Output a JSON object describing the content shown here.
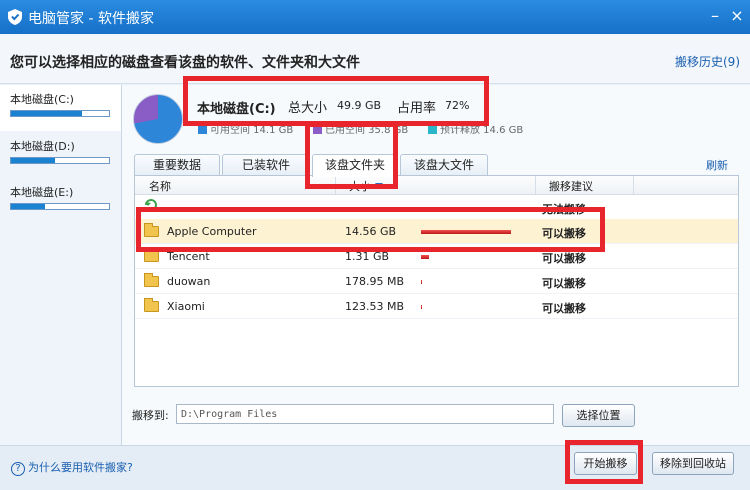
{
  "window": {
    "title": "电脑管家 - 软件搬家"
  },
  "header": {
    "message": "您可以选择相应的磁盘查看该盘的软件、文件夹和大文件",
    "history_link": "搬移历史(9)"
  },
  "sidebar": {
    "drives": [
      {
        "label": "本地磁盘(C:)",
        "usage": 0.72,
        "selected": true
      },
      {
        "label": "本地磁盘(D:)",
        "usage": 0.45,
        "selected": false
      },
      {
        "label": "本地磁盘(E:)",
        "usage": 0.35,
        "selected": false
      }
    ]
  },
  "disk": {
    "name": "本地磁盘(C:)",
    "total_label": "总大小",
    "total_value": "49.9 GB",
    "usage_label": "占用率",
    "usage_value": "72%",
    "legend": [
      {
        "text": "可用空间 14.1 GB",
        "color": "#2e86d8"
      },
      {
        "text": "已用空间 35.8 GB",
        "color": "#8a5cc6"
      },
      {
        "text": "预计释放 14.6 GB",
        "color": "#29b6c8"
      }
    ]
  },
  "tabs": [
    {
      "label": "重要数据"
    },
    {
      "label": "已装软件"
    },
    {
      "label": "该盘文件夹",
      "active": true
    },
    {
      "label": "该盘大文件"
    }
  ],
  "refresh_label": "刷新",
  "table": {
    "columns": [
      "名称",
      "大小",
      "搬移建议"
    ],
    "rows": [
      {
        "name": "",
        "size": "",
        "suggestion": "无法搬移",
        "bar": 0
      },
      {
        "name": "Apple Computer",
        "size": "14.56 GB",
        "suggestion": "可以搬移",
        "bar": 0.9,
        "selected": true
      },
      {
        "name": "Tencent",
        "size": "1.31 GB",
        "suggestion": "可以搬移",
        "bar": 0.08
      },
      {
        "name": "duowan",
        "size": "178.95 MB",
        "suggestion": "可以搬移",
        "bar": 0.01
      },
      {
        "name": "Xiaomi",
        "size": "123.53 MB",
        "suggestion": "可以搬移",
        "bar": 0.01
      }
    ]
  },
  "move": {
    "label": "搬移到:",
    "path": "D:\\Program Files",
    "choose_button": "选择位置"
  },
  "footer": {
    "help": "为什么要用软件搬家?",
    "start_button": "开始搬移",
    "recycle_button": "移除到回收站"
  }
}
